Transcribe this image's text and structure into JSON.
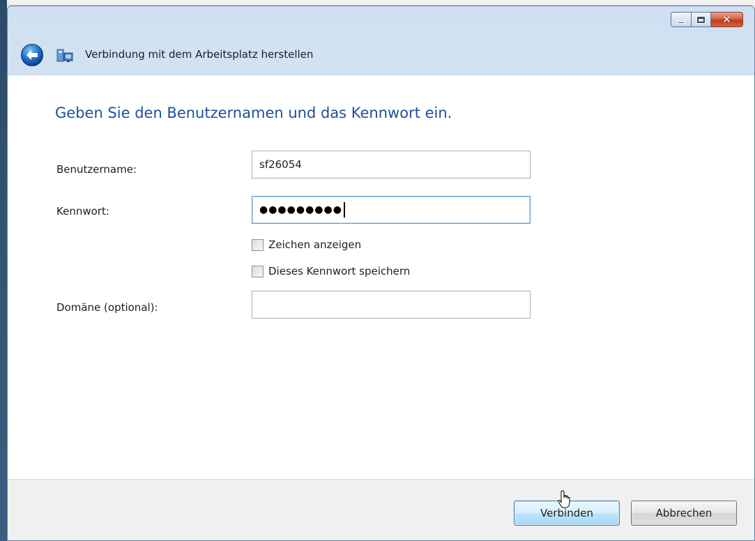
{
  "window": {
    "title": "Verbindung mit dem Arbeitsplatz herstellen",
    "controls": {
      "minimize": "minimize-icon",
      "maximize": "maximize-icon",
      "close": "close-icon"
    }
  },
  "navbar": {
    "back_icon": "back-arrow-icon",
    "app_icon": "remote-desktop-icon"
  },
  "dialog": {
    "heading": "Geben Sie den Benutzernamen und das Kennwort ein.",
    "fields": {
      "username_label": "Benutzername:",
      "username_value": "sf26054",
      "password_label": "Kennwort:",
      "password_value": "●●●●●●●●●",
      "domain_label": "Domäne (optional):",
      "domain_value": ""
    },
    "checkboxes": {
      "show_chars_label": "Zeichen anzeigen",
      "show_chars_checked": false,
      "save_password_label": "Dieses Kennwort speichern",
      "save_password_checked": false
    }
  },
  "footer": {
    "connect_label": "Verbinden",
    "cancel_label": "Abbrechen"
  },
  "colors": {
    "heading": "#1f4f99",
    "accent": "#3c7fb1",
    "close_button": "#c1391d"
  }
}
